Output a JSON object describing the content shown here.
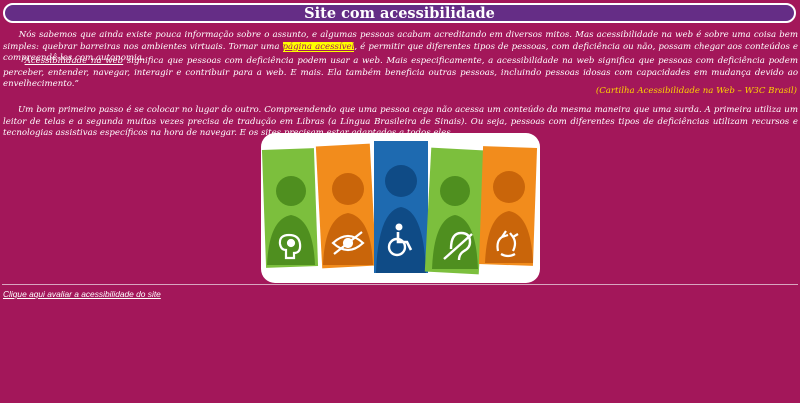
{
  "page": {
    "title": "Site com acessibilidade"
  },
  "intro": {
    "before_link": "Nós sabemos que ainda existe pouca informação sobre o assunto, e algumas pessoas acabam acreditando em diversos mitos. Mas acessibilidade na web é sobre uma coisa bem simples: quebrar barreiras nos ambientes virtuais. Tornar uma ",
    "link_text": "página acessível",
    "after_link": ", é permitir que diferentes tipos de pessoas, com deficiência ou não, possam chegar aos conteúdos e compreendê-los com autonomia."
  },
  "quote": {
    "open_mark": "“",
    "term": "Acessibilidade na web",
    "text": " significa que pessoas com deficiência podem usar a web. Mais especificamente, a acessibilidade na web significa que pessoas com deficiência podem perceber, entender, navegar, interagir e contribuir para a web. E mais. Ela também beneficia outras pessoas, incluindo pessoas idosas com capacidades em mudança devido ao envelhecimento.”",
    "source": "(Cartilha Acessibilidade na Web – W3C Brasil)"
  },
  "paragraph3": {
    "text": "Um bom primeiro passo é se colocar no lugar do outro. Compreendendo que uma pessoa cega não acessa um conteúdo da mesma maneira que uma surda. A primeira utiliza um leitor de telas e a segunda muitas vezes precisa de tradução em Libras (a Língua Brasileira de Sinais). Ou seja, pessoas com diferentes tipos de deficiências utilizam recursos e tecnologias assistivas específicos na hora de navegar. E os sites precisam estar adaptados a todos eles."
  },
  "banner": {
    "panels": [
      {
        "color": "#7cbf3d",
        "icon": "brain-icon"
      },
      {
        "color": "#f28c1c",
        "icon": "eye-icon"
      },
      {
        "color": "#1e6ab0",
        "icon": "wheelchair-icon"
      },
      {
        "color": "#7cbf3d",
        "icon": "ear-icon"
      },
      {
        "color": "#f28c1c",
        "icon": "sign-language-icon"
      }
    ]
  },
  "footer": {
    "link_label": "Clique aqui avaliar a acessibilidade do site"
  },
  "colors": {
    "background": "#a3175a",
    "title_bar": "#652d86",
    "highlight": "#ffff00",
    "source_text": "#ffd400"
  }
}
